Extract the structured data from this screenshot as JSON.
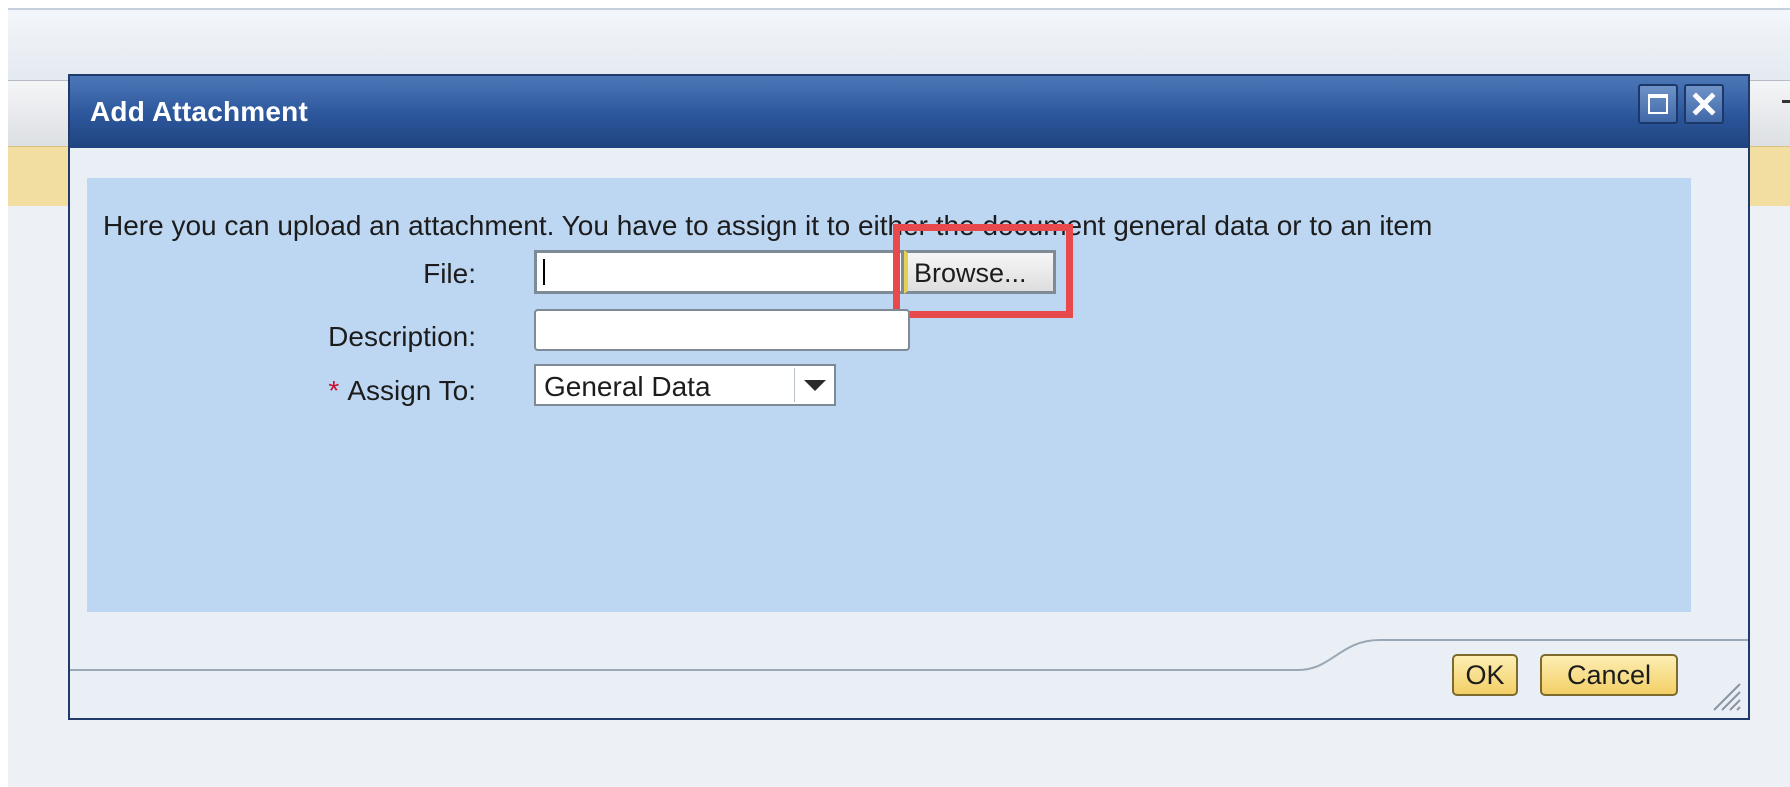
{
  "dialog": {
    "title": "Add Attachment",
    "intro_text": "Here you can upload an attachment. You have to assign it to either the document general data or to an item",
    "fields": {
      "file_label": "File:",
      "file_value": "",
      "browse_label": "Browse...",
      "description_label": "Description:",
      "description_value": "",
      "required_marker": "*",
      "assign_label": "Assign To:",
      "assign_value": "General Data"
    },
    "buttons": {
      "ok": "OK",
      "cancel": "Cancel"
    },
    "icons": {
      "maximize": "maximize-icon",
      "close": "close-icon",
      "resize": "resize-grip-icon",
      "dropdown": "chevron-down-icon"
    }
  },
  "colors": {
    "title_bar": "#2c569b",
    "content_bg": "#bdd7f3",
    "highlight": "#e8494d",
    "button_gold": "#f3cf66",
    "required": "#c8102e"
  }
}
